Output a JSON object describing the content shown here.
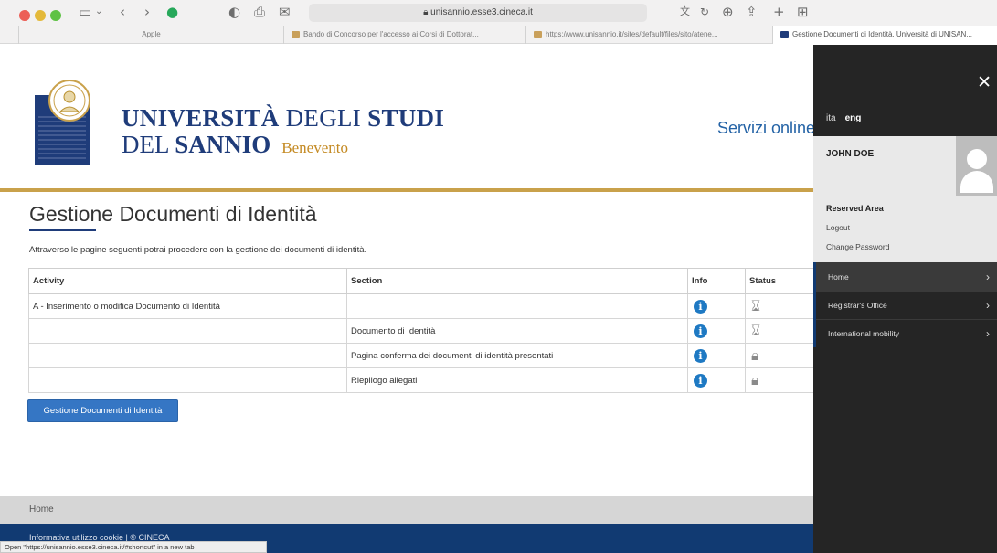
{
  "browser": {
    "url": "unisannio.esse3.cineca.it",
    "tabs": [
      {
        "label": "Apple"
      },
      {
        "label": "Bando di Concorso per l'accesso ai Corsi di Dottorat..."
      },
      {
        "label": "https://www.unisannio.it/sites/default/files/sito/atene..."
      },
      {
        "label": "Gestione Documenti di Identità, Università di UNISAN..."
      }
    ],
    "status_bar": "Open \"https://unisannio.esse3.cineca.it/#shortcut\" in a new tab"
  },
  "header": {
    "uni_line1_bold": "UNIVERSITÀ",
    "uni_line1_rest": " DEGLI ",
    "uni_line1_bold2": "STUDI",
    "uni_line2_a": "DEL ",
    "uni_line2_b": "SANNIO",
    "uni_city": "Benevento",
    "servizi": "Servizi online"
  },
  "main": {
    "title": "Gestione Documenti di Identità",
    "intro": "Attraverso le pagine seguenti potrai procedere con la gestione dei documenti di identità.",
    "columns": [
      "Activity",
      "Section",
      "Info",
      "Status"
    ],
    "rows": [
      {
        "activity": "A - Inserimento o modifica Documento di Identità",
        "section": "",
        "status": "hourglass"
      },
      {
        "activity": "",
        "section": "Documento di Identità",
        "status": "hourglass"
      },
      {
        "activity": "",
        "section": "Pagina conferma dei documenti di identità presentati",
        "status": "lock"
      },
      {
        "activity": "",
        "section": "Riepilogo allegati",
        "status": "lock"
      }
    ],
    "button": "Gestione Documenti di Identità"
  },
  "footer": {
    "home": "Home",
    "cookie": "Informativa utilizzo cookie | © CINECA"
  },
  "sidebar": {
    "lang_ita": "ita",
    "lang_eng": "eng",
    "user_name": "JOHN DOE",
    "reserved_area": "Reserved Area",
    "logout": "Logout",
    "change_password": "Change Password",
    "menu": [
      {
        "label": "Home"
      },
      {
        "label": "Registrar's Office"
      },
      {
        "label": "International mobility"
      }
    ]
  },
  "colors": {
    "accent": "#1f3c7a",
    "gold": "#c9a14b",
    "button": "#3576c4"
  }
}
